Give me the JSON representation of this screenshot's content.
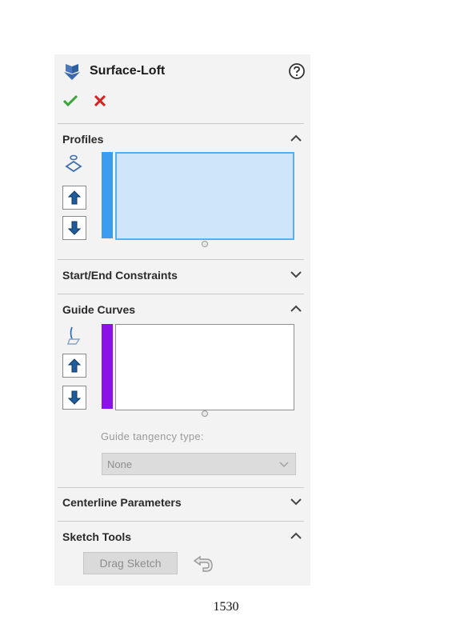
{
  "feature": {
    "title": "Surface-Loft",
    "help_icon": "help-circle-icon",
    "ok_icon": "checkmark-icon",
    "cancel_icon": "close-x-icon"
  },
  "sections": {
    "profiles": {
      "title": "Profiles",
      "expanded": true,
      "selection_icon": "profile-selection-icon",
      "color": "#3c9cf0"
    },
    "start_end": {
      "title": "Start/End Constraints",
      "expanded": false
    },
    "guide_curves": {
      "title": "Guide Curves",
      "expanded": true,
      "selection_icon": "guide-curve-selection-icon",
      "color": "#8a12e6"
    },
    "guide_tangency": {
      "label": "Guide tangency type:",
      "value": "None",
      "disabled": true
    },
    "centerline": {
      "title": "Centerline Parameters",
      "expanded": false
    },
    "sketch_tools": {
      "title": "Sketch Tools",
      "expanded": true,
      "drag_sketch_label": "Drag Sketch",
      "undo_icon": "undo-icon"
    }
  },
  "page_number": "1530"
}
